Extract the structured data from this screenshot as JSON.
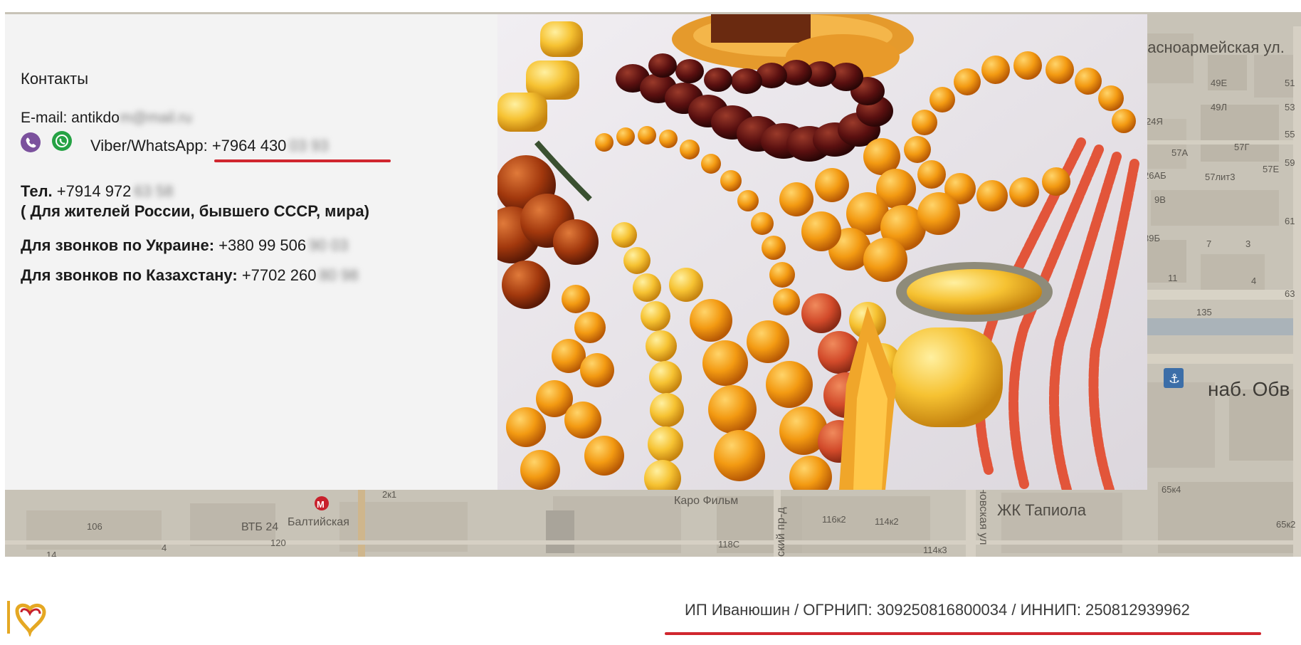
{
  "contacts": {
    "heading": "Контакты",
    "email_label": "E-mail: antikdo",
    "email_hidden": "m@mail.ru",
    "messenger_label": "Viber/WhatsApp:",
    "messenger_phone": "+7964 430",
    "messenger_hidden": "03 93",
    "tel_label": "Тел.",
    "tel_phone": "+7914 972",
    "tel_hidden": "63 58",
    "tel_note": "( Для жителей России, бывшего СССР, мира)",
    "ukraine_label": "Для звонков по Украине:",
    "ukraine_phone": "+380 99 506",
    "ukraine_hidden": "90 03",
    "kz_label": "Для звонков по Казахстану:",
    "kz_phone": "+7702 260",
    "kz_hidden": "80 98"
  },
  "map": {
    "labels": {
      "street_krasnoarmeyskaya": "расноармейская ул.",
      "b49e": "49Е",
      "b51": "51",
      "b49l": "49Л",
      "b53": "53",
      "b24ya": "24Я",
      "b57a": "57А",
      "b57g": "57Г",
      "b55": "55",
      "b26ab": "26АБ",
      "b57lit3": "57лит3",
      "b57e": "57Е",
      "b59": "59",
      "b9v": "9В",
      "b61": "61",
      "b39b": "39Б",
      "b7": "7",
      "b3": "3",
      "b11": "11",
      "b4": "4",
      "b63": "63",
      "b135": "135",
      "embankment": "наб. Обв",
      "b106": "106",
      "vtb": "ВТБ 24",
      "baltiyskaya": "Балтийская",
      "b120": "120",
      "b4b": "4",
      "b14": "14",
      "b2k1": "2к1",
      "karo": "Каро Фильм",
      "prospekt": "ский пр-д",
      "b116k2": "116к2",
      "b114k2": "114к2",
      "b118s": "118С",
      "b114k3": "114к3",
      "ul": "новская ул",
      "tapiola": "ЖК Тапиола",
      "b65k4": "65к4",
      "b65k2": "65к2"
    }
  },
  "footer": {
    "legal": "ИП Иванюшин / ОГРНИП: 309250816800034 / ИННИП: 250812939962"
  },
  "colors": {
    "accent_red": "#d0262e",
    "viber": "#7b519d",
    "whatsapp": "#25a244",
    "logo_gold": "#e5a823",
    "logo_red": "#c8202b"
  }
}
